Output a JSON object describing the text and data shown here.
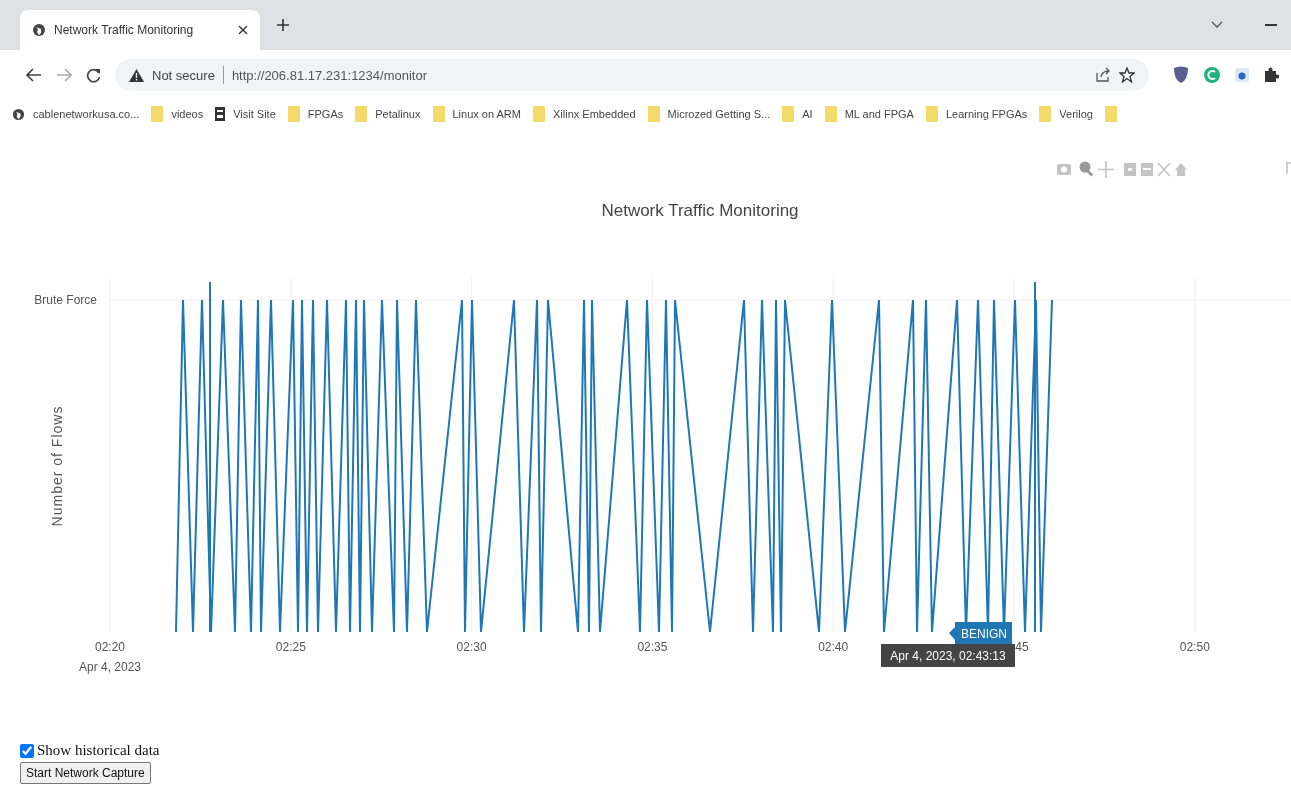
{
  "browser": {
    "tab": {
      "title": "Network Traffic Monitoring"
    },
    "address": {
      "security": "Not secure",
      "url": "http://206.81.17.231:1234/monitor"
    },
    "bookmarks": [
      {
        "label": "cablenetworkusa.co...",
        "kind": "site"
      },
      {
        "label": "videos",
        "kind": "folder"
      },
      {
        "label": "Visit Site",
        "kind": "page"
      },
      {
        "label": "FPGAs",
        "kind": "folder"
      },
      {
        "label": "Petalinux",
        "kind": "folder"
      },
      {
        "label": "Linux on ARM",
        "kind": "folder"
      },
      {
        "label": "Xilinx Embedded",
        "kind": "folder"
      },
      {
        "label": "Microzed Getting S...",
        "kind": "folder"
      },
      {
        "label": "AI",
        "kind": "folder"
      },
      {
        "label": "ML and FPGA",
        "kind": "folder"
      },
      {
        "label": "Learning FPGAs",
        "kind": "folder"
      },
      {
        "label": "Verilog",
        "kind": "folder"
      }
    ]
  },
  "chart": {
    "title": "Network Traffic Monitoring",
    "ylabel": "Number of Flows",
    "ytick": "Brute Force",
    "xticks": [
      {
        "label": "02:20",
        "sublabel": "Apr 4, 2023"
      },
      {
        "label": "02:25"
      },
      {
        "label": "02:30"
      },
      {
        "label": "02:35"
      },
      {
        "label": "02:40"
      },
      {
        "label": "45"
      },
      {
        "label": "02:50"
      }
    ],
    "hover": {
      "value": "BENIGN",
      "time": "Apr 4, 2023, 02:43:13"
    }
  },
  "controls": {
    "historical": {
      "label": "Show historical data",
      "checked": true
    },
    "capture_button": "Start Network Capture"
  }
}
